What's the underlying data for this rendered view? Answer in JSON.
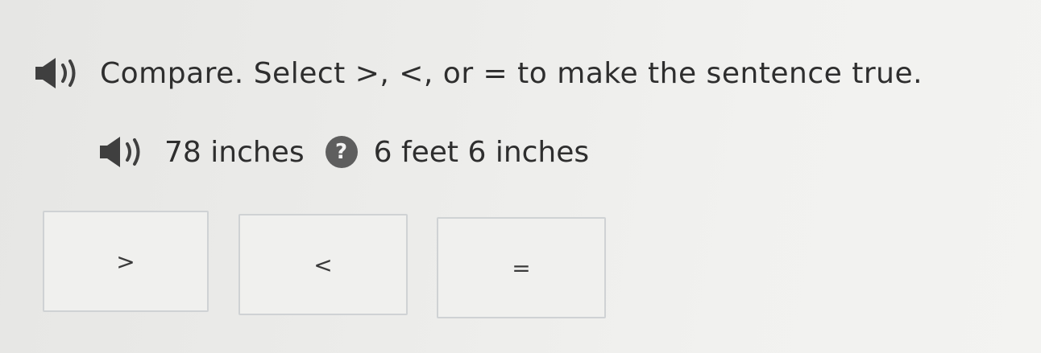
{
  "instruction": {
    "icon": "speaker-icon",
    "text": "Compare. Select >, <, or = to make the sentence true."
  },
  "expression": {
    "icon": "speaker-icon",
    "left": "78 inches",
    "unknown_symbol": "?",
    "right": "6 feet 6 inches"
  },
  "choices": [
    {
      "label": ">"
    },
    {
      "label": "<"
    },
    {
      "label": "="
    }
  ],
  "colors": {
    "text": "#2e2e2e",
    "icon": "#3f3f3f",
    "badge": "#5e5e5e",
    "choice_border": "#cfd2d4"
  }
}
